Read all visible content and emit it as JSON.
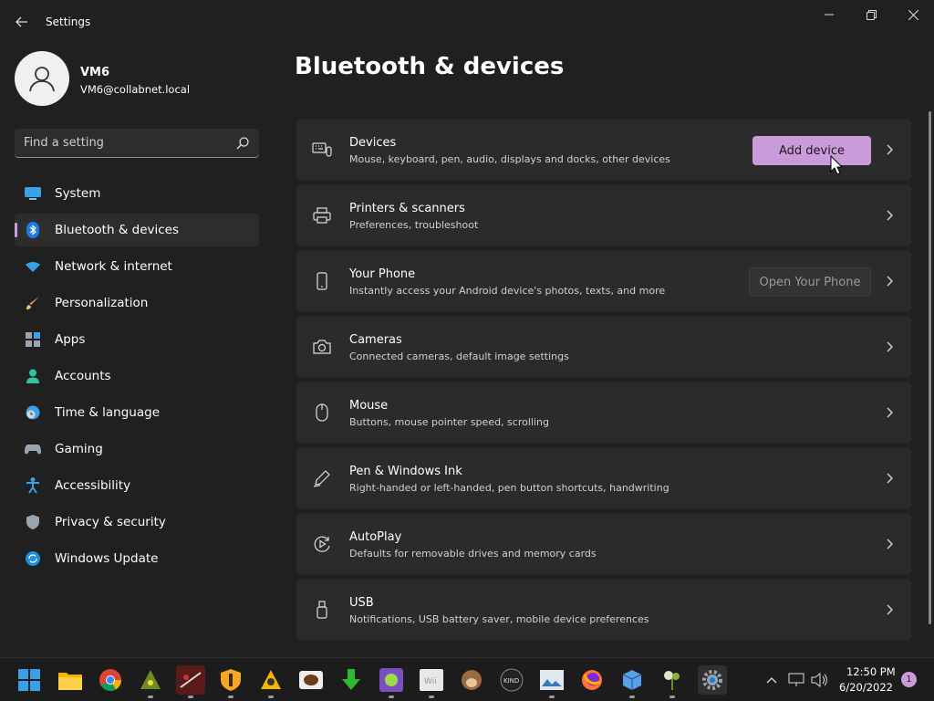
{
  "window": {
    "title": "Settings"
  },
  "profile": {
    "name": "VM6",
    "email": "VM6@collabnet.local"
  },
  "search": {
    "placeholder": "Find a setting"
  },
  "nav": {
    "items": [
      {
        "label": "System",
        "icon": "monitor-icon"
      },
      {
        "label": "Bluetooth & devices",
        "icon": "bluetooth-icon",
        "active": true
      },
      {
        "label": "Network & internet",
        "icon": "wifi-icon"
      },
      {
        "label": "Personalization",
        "icon": "brush-icon"
      },
      {
        "label": "Apps",
        "icon": "apps-icon"
      },
      {
        "label": "Accounts",
        "icon": "person-icon"
      },
      {
        "label": "Time & language",
        "icon": "clock-globe-icon"
      },
      {
        "label": "Gaming",
        "icon": "gamepad-icon"
      },
      {
        "label": "Accessibility",
        "icon": "accessibility-icon"
      },
      {
        "label": "Privacy & security",
        "icon": "shield-icon"
      },
      {
        "label": "Windows Update",
        "icon": "update-icon"
      }
    ]
  },
  "main": {
    "title": "Bluetooth & devices",
    "cards": [
      {
        "title": "Devices",
        "subtitle": "Mouse, keyboard, pen, audio, displays and docks, other devices",
        "icon": "devices-icon",
        "button": "Add device"
      },
      {
        "title": "Printers & scanners",
        "subtitle": "Preferences, troubleshoot",
        "icon": "printer-icon"
      },
      {
        "title": "Your Phone",
        "subtitle": "Instantly access your Android device's photos, texts, and more",
        "icon": "phone-icon",
        "button": "Open Your Phone"
      },
      {
        "title": "Cameras",
        "subtitle": "Connected cameras, default image settings",
        "icon": "camera-icon"
      },
      {
        "title": "Mouse",
        "subtitle": "Buttons, mouse pointer speed, scrolling",
        "icon": "mouse-icon"
      },
      {
        "title": "Pen & Windows Ink",
        "subtitle": "Right-handed or left-handed, pen button shortcuts, handwriting",
        "icon": "pen-icon"
      },
      {
        "title": "AutoPlay",
        "subtitle": "Defaults for removable drives and memory cards",
        "icon": "autoplay-icon"
      },
      {
        "title": "USB",
        "subtitle": "Notifications, USB battery saver, mobile device preferences",
        "icon": "usb-icon"
      }
    ]
  },
  "taskbar": {
    "apps": [
      "start-icon",
      "file-explorer-icon",
      "chrome-icon",
      "app-icon",
      "sky-app-icon",
      "shield-app-icon",
      "tools-app-icon",
      "coffee-app-icon",
      "download-app-icon",
      "game-app-icon",
      "wii-app-icon",
      "monkey-app-icon",
      "kindle-app-icon",
      "photo-app-icon",
      "firefox-app-icon",
      "box-app-icon",
      "plant-app-icon",
      "settings-app-icon"
    ],
    "time": "12:50 PM",
    "date": "6/20/2022",
    "notifications": "1"
  },
  "colors": {
    "accent": "#c99bdb",
    "background": "#202020",
    "card": "#2b2b2b"
  }
}
